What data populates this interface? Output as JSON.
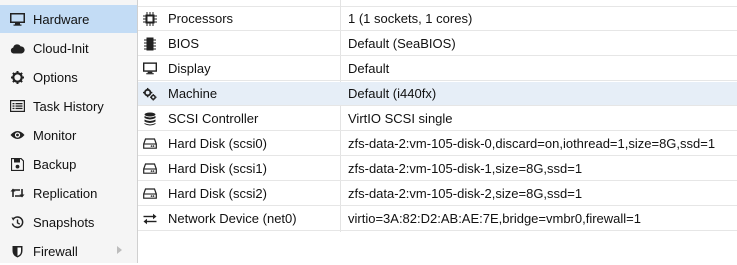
{
  "sidebar": {
    "items": [
      {
        "label": "Hardware",
        "icon": "monitor-icon",
        "selected": true
      },
      {
        "label": "Cloud-Init",
        "icon": "cloud-icon"
      },
      {
        "label": "Options",
        "icon": "gear-icon"
      },
      {
        "label": "Task History",
        "icon": "list-icon"
      },
      {
        "label": "Monitor",
        "icon": "eye-icon"
      },
      {
        "label": "Backup",
        "icon": "floppy-icon"
      },
      {
        "label": "Replication",
        "icon": "retweet-icon"
      },
      {
        "label": "Snapshots",
        "icon": "history-icon"
      },
      {
        "label": "Firewall",
        "icon": "shield-icon",
        "has_submenu": true
      }
    ]
  },
  "hardware": {
    "rows": [
      {
        "name": "Processors",
        "value": "1 (1 sockets, 1 cores)",
        "icon": "cpu-icon"
      },
      {
        "name": "BIOS",
        "value": "Default (SeaBIOS)",
        "icon": "microchip-icon"
      },
      {
        "name": "Display",
        "value": "Default",
        "icon": "desktop-icon"
      },
      {
        "name": "Machine",
        "value": "Default (i440fx)",
        "icon": "cogs-icon",
        "selected": true
      },
      {
        "name": "SCSI Controller",
        "value": "VirtIO SCSI single",
        "icon": "database-icon"
      },
      {
        "name": "Hard Disk (scsi0)",
        "value": "zfs-data-2:vm-105-disk-0,discard=on,iothread=1,size=8G,ssd=1",
        "icon": "hdd-icon"
      },
      {
        "name": "Hard Disk (scsi1)",
        "value": "zfs-data-2:vm-105-disk-1,size=8G,ssd=1",
        "icon": "hdd-icon"
      },
      {
        "name": "Hard Disk (scsi2)",
        "value": "zfs-data-2:vm-105-disk-2,size=8G,ssd=1",
        "icon": "hdd-icon"
      },
      {
        "name": "Network Device (net0)",
        "value": "virtio=3A:82:D2:AB:AE:7E,bridge=vmbr0,firewall=1",
        "icon": "exchange-icon"
      }
    ]
  },
  "colors": {
    "selected_nav": "#c3dcf5",
    "selected_row": "#e6eef7"
  }
}
